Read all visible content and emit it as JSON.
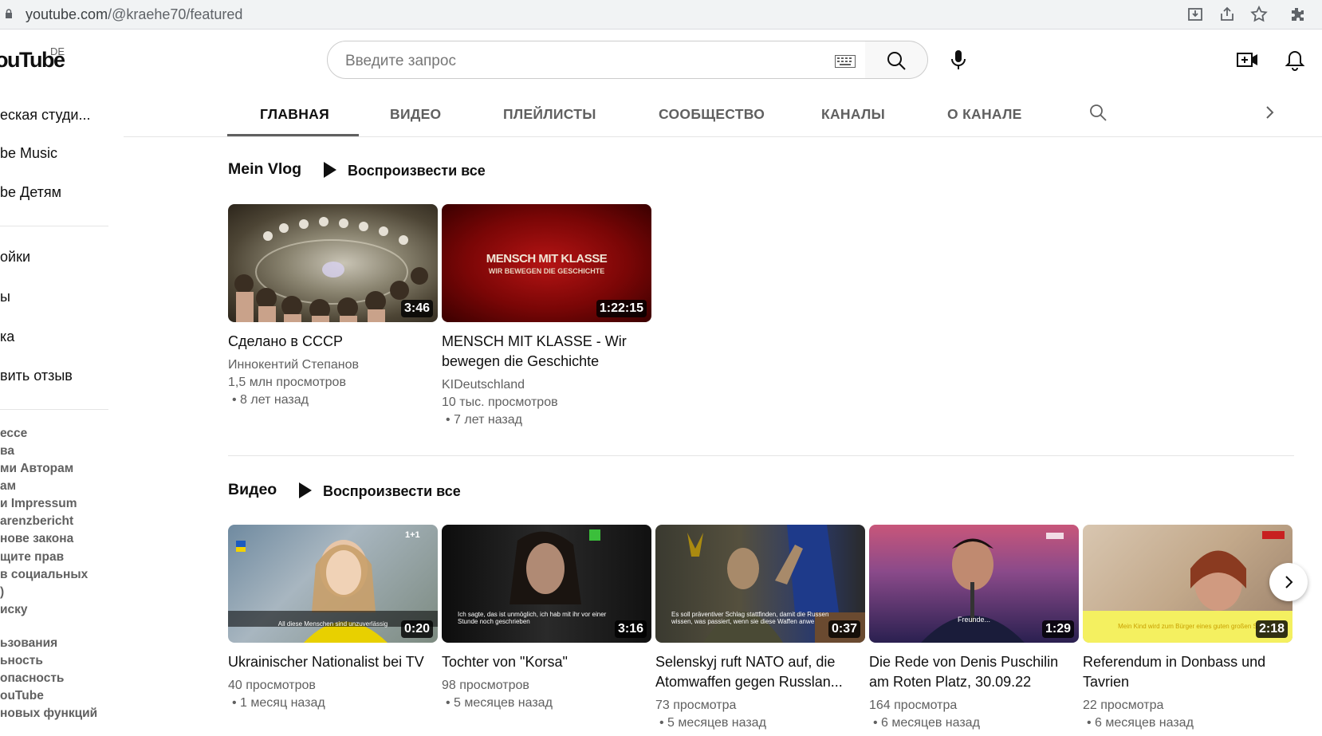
{
  "browser": {
    "url_host": "youtube.com",
    "url_path": "/@kraehe70/featured"
  },
  "masthead": {
    "logo_text": "ouTube",
    "region": "DE",
    "search_placeholder": "Введите запрос"
  },
  "sidebar": {
    "items": [
      "еская студи...",
      "be Music",
      "be Детям",
      "ойки",
      "ы",
      "ка",
      "вить отзыв"
    ],
    "footer_links": [
      "ессе",
      "ва",
      "ми   Авторам",
      "ам",
      "и   Impressum",
      "arenzbericht",
      "нове закона",
      "щите прав",
      "  в социальных",
      ")",
      "иску",
      "ьзования",
      "ьность",
      "опасность",
      "ouTube",
      "новых функций"
    ]
  },
  "tabs": [
    "ГЛАВНАЯ",
    "ВИДЕО",
    "ПЛЕЙЛИСТЫ",
    "СООБЩЕСТВО",
    "КАНАЛЫ",
    "О КАНАЛЕ"
  ],
  "shelves": [
    {
      "title": "Mein Vlog",
      "play_all": "Воспроизвести все",
      "videos": [
        {
          "title": "Сделано в СССР",
          "channel": "Иннокентий Степанов",
          "views": "1,5 млн просмотров",
          "age": "• 8 лет назад",
          "duration": "3:46"
        },
        {
          "title": "MENSCH MIT KLASSE - Wir bewegen die Geschichte",
          "channel": "KIDeutschland",
          "views": "10 тыс. просмотров",
          "age": "• 7 лет назад",
          "duration": "1:22:15",
          "thumb_text_1": "MENSCH MIT KLASSE",
          "thumb_text_2": "WIR BEWEGEN DIE GESCHICHTE"
        }
      ]
    },
    {
      "title": "Видео",
      "play_all": "Воспроизвести все",
      "videos": [
        {
          "title": "Ukrainischer Nationalist bei TV",
          "views": "40 просмотров",
          "age": "• 1 месяц назад",
          "duration": "0:20",
          "caption": "All diese Menschen sind unzuverlässig"
        },
        {
          "title": "Tochter von \"Korsa\"",
          "views": "98 просмотров",
          "age": "• 5 месяцев назад",
          "duration": "3:16",
          "caption": "Ich sagte, das ist unmöglich, ich hab mit ihr vor einer Stunde noch geschrieben"
        },
        {
          "title": "Selenskyj ruft NATO auf, die Atomwaffen gegen Russlan...",
          "views": "73 просмотра",
          "age": "• 5 месяцев назад",
          "duration": "0:37",
          "caption": "Es soll präventiver Schlag stattfinden, damit die Russen wissen, was passiert, wenn sie diese Waffen anwe"
        },
        {
          "title": "Die Rede von Denis Puschilin am Roten Platz, 30.09.22",
          "views": "164 просмотра",
          "age": "• 6 месяцев назад",
          "duration": "1:29",
          "caption": "Freunde..."
        },
        {
          "title": "Referendum in Donbass und Tavrien",
          "views": "22 просмотра",
          "age": "• 6 месяцев назад",
          "duration": "2:18",
          "caption": "Mein Kind wird zum Bürger eines guten großen S"
        }
      ]
    }
  ]
}
